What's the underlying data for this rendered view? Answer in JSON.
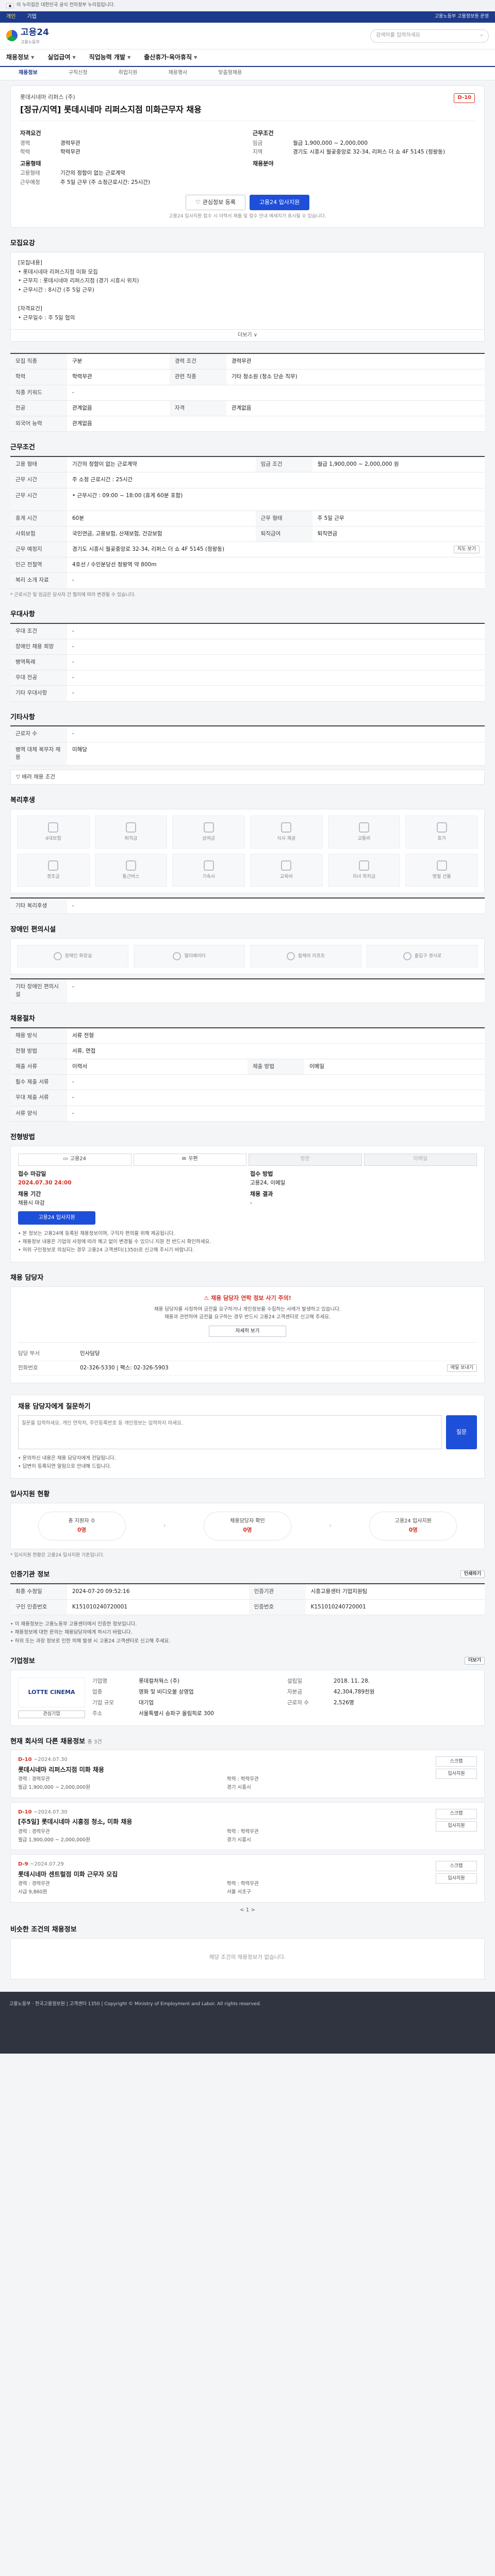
{
  "gov_bar": {
    "text": "이 누리집은 대한민국 공식 전자정부 누리집입니다."
  },
  "util_bar": {
    "items": [
      "개인",
      "기업"
    ],
    "active": "개인",
    "right": "고용노동부 고용정보원 운영"
  },
  "logo": {
    "name": "고용24",
    "sub": "고용노동부"
  },
  "search": {
    "placeholder": "검색어를 입력하세요"
  },
  "main_nav": [
    "채용정보",
    "실업급여",
    "직업능력 개발",
    "출산휴가·육아휴직"
  ],
  "sub_nav": [
    "채용정보",
    "구직신청",
    "취업지원",
    "채용행사",
    "맞춤형채용"
  ],
  "job": {
    "company": "롯데시네마 리퍼스 (주)",
    "title": "[정규/지역] 롯데시네마 리퍼스지점 미화근무자 채용",
    "dday": "D-10",
    "left_block_title": "자격요건",
    "left_kv": [
      [
        "경력",
        "경력무관"
      ],
      [
        "학력",
        "학력무관"
      ]
    ],
    "right_block_title": "근무조건",
    "right_kv": [
      [
        "임금",
        "월급 1,900,000 ~ 2,000,000"
      ],
      [
        "지역",
        "경기도 시흥시 월곶중앙로 32-34, 리퍼스 더 쇼 4F 5145 (정왕동)"
      ]
    ],
    "left_block2_title": "고용형태",
    "left_kv2": [
      [
        "고용형태",
        "기간의 정함이 없는 근로계약"
      ],
      [
        "근무예정",
        "주 5일 근무 (주 소정근로시간: 25시간)"
      ]
    ],
    "right_block2_title": "채용분야",
    "buttons": {
      "save": "관심정보 등록",
      "apply": "고용24 입사지원"
    },
    "note": "고용24 입사지원 접수 시 이력서 제출 및 접수 안내 메세지가 표시될 수 있습니다."
  },
  "recruit": {
    "title": "모집요강",
    "body": "[모집내용]\n• 롯데시네마 리퍼스지점 미화 모집\n• 근무지 : 롯데시네마 리퍼스지점 (경기 시흥시 위치)\n• 근무시간 : 8시간 (주 5일 근무)\n\n[자격요건]\n• 근무일수 : 주 5일 협의",
    "more": "더보기 ∨"
  },
  "qual_table": {
    "rows": [
      [
        "모집 직종",
        "구분",
        "경력 조건",
        "경력무관"
      ],
      [
        "학력",
        "학력무관",
        "관련 직종",
        "기타 청소원 (청소 단순 직무)"
      ],
      [
        "직종 키워드",
        "-",
        "",
        ""
      ],
      [
        "전공",
        "관계없음",
        "자격",
        "관계없음"
      ],
      [
        "외국어 능력",
        "관계없음",
        "",
        ""
      ]
    ]
  },
  "conditions": {
    "title": "근무조건",
    "rows": [
      [
        "고용 형태",
        "기간의 정함이 없는 근로계약",
        "임금 조건",
        "월급 1,900,000 ~ 2,000,000 원"
      ],
      [
        "근무 시간",
        "주 소정 근로시간 : 25시간",
        "",
        ""
      ],
      [
        "근무 시간",
        "• 근무시간 : 09:00 ~ 18:00 (휴게 60분 포함)",
        "",
        ""
      ],
      [
        "휴게 시간",
        "60분",
        "근무 형태",
        "주 5일 근무"
      ],
      [
        "사회보험",
        "국민연금, 고용보험, 산재보험, 건강보험",
        "퇴직급여",
        "퇴직연금"
      ],
      [
        "근무 예정지",
        "경기도 시흥시 월곶중앙로 32-34, 리퍼스 더 쇼 4F 5145 (정왕동)",
        "",
        ""
      ],
      [
        "인근 전철역",
        "4호선 / 수인분당선 정왕역 약 800m",
        "",
        ""
      ],
      [
        "복리 소개 자료",
        "-",
        "",
        ""
      ]
    ],
    "map_btn": "지도 보기",
    "note": "* 근로시간 및 임금은 당사자 간 협의에 따라 변경될 수 있습니다."
  },
  "prefer": {
    "title": "우대사항",
    "rows": [
      [
        "우대 조건",
        "-"
      ],
      [
        "장애인 채용 희망",
        "-"
      ],
      [
        "병역특례",
        "-"
      ],
      [
        "우대 전공",
        "-"
      ],
      [
        "기타 우대사항",
        "-"
      ]
    ]
  },
  "other_info": {
    "title": "기타사항",
    "rows": [
      [
        "근로자 수",
        "-"
      ],
      [
        "병역 대체 복무자 채용",
        "미해당"
      ]
    ],
    "dropdown": "배려 채용 조건"
  },
  "welfare": {
    "title": "복리후생",
    "icons": [
      "4대보험",
      "퇴직금",
      "상여금",
      "식사 제공",
      "교통비",
      "휴가",
      "경조금",
      "통근버스",
      "기숙사",
      "교육비",
      "자녀 학자금",
      "명절 선물"
    ],
    "etc_label": "기타 복리후생",
    "etc_value": "-"
  },
  "disability": {
    "title": "장애인 편의시설",
    "icons": [
      "장애인 화장실",
      "엘리베이터",
      "휠체어 리프트",
      "출입구 경사로"
    ],
    "etc_label": "기타 장애인 편의시설",
    "etc_value": "-"
  },
  "selection": {
    "title": "채용절차",
    "rows": [
      [
        "채용 방식",
        "서류 전형",
        "",
        ""
      ],
      [
        "전형 방법",
        "서류, 면접",
        "",
        ""
      ],
      [
        "제출 서류",
        "이력서",
        "제출 방법",
        "이메일"
      ],
      [
        "필수 제출 서류",
        "-",
        "",
        ""
      ],
      [
        "우대 제출 서류",
        "-",
        "",
        ""
      ],
      [
        "서류 양식",
        "-",
        "",
        ""
      ]
    ]
  },
  "apply": {
    "title": "전형방법",
    "tabs": [
      "고용24",
      "우편",
      "방문",
      "이메일"
    ],
    "deadline_label": "접수 마감일",
    "deadline": "2024.07.30 24:00",
    "method_label": "접수 방법",
    "method": "고용24, 이메일",
    "period_label": "채용 기간",
    "period_value": "채용시 마감",
    "result_label": "채용 결과",
    "result_value": "-",
    "apply_btn": "고용24 입사지원",
    "bullets": [
      "• 본 정보는 고용24에 등록된 채용정보이며, 구직자 편의를 위해 제공됩니다.",
      "• 채용정보 내용은 기업의 사정에 따라 예고 없이 변경될 수 있으니 지원 전 반드시 확인하세요.",
      "• 허위 구인정보로 의심되는 경우 고용24 고객센터(1350)로 신고해 주시기 바랍니다."
    ]
  },
  "contact": {
    "title": "채용 담당자",
    "warn": "채용 담당자 연락 정보 사기 주의!",
    "warn_sub": "채용 담당자를 사칭하여 금전을 요구하거나 개인정보를 수집하는 사례가 발생하고 있습니다.\n채용과 관련하여 금전을 요구하는 경우 반드시 고용24 고객센터로 신고해 주세요.",
    "warn_btn": "자세히 보기",
    "rows": [
      [
        "담당 부서",
        "인사담당"
      ],
      [
        "전화번호",
        "02-326-5330  |  팩스: 02-326-5903"
      ]
    ],
    "email_btn": "메일 보내기"
  },
  "inquiry": {
    "title": "채용 담당자에게 질문하기",
    "placeholder": "질문을 입력하세요. 개인 연락처, 주민등록번호 등 개인정보는 입력하지 마세요.",
    "submit": "질문",
    "notes": [
      "• 문의하신 내용은 채용 담당자에게 전달됩니다.",
      "• 답변이 등록되면 알림으로 안내해 드립니다."
    ]
  },
  "status": {
    "title": "입사지원 현황",
    "steps": [
      [
        "총 지원자 수",
        "0명"
      ],
      [
        "채용담당자 확인",
        "0명"
      ],
      [
        "고용24 입사지원",
        "0명"
      ]
    ],
    "note": "* 입사지원 현황은 고용24 입사지원 기준입니다."
  },
  "reg_info": {
    "title": "인증기관 정보",
    "rows": [
      [
        "최종 수정일",
        "2024-07-20 09:52:16",
        "인증기관",
        "시흥고용센터 기업지원팀"
      ],
      [
        "구인 인증번호",
        "K151010240720001",
        "인증번호",
        "K151010240720001"
      ]
    ],
    "btn": "인쇄하기",
    "bullets": [
      "• 이 채용정보는 고용노동부 고용센터에서 인증한 정보입니다.",
      "• 채용정보에 대한 문의는 채용담당자에게 하시기 바랍니다.",
      "• 허위 또는 과장 정보로 인한 피해 발생 시 고용24 고객센터로 신고해 주세요."
    ]
  },
  "company": {
    "title": "기업정보",
    "more": "더보기",
    "logo_text": "LOTTE CINEMA",
    "follow_btn": "관심기업",
    "rows": [
      [
        "기업명",
        "롯데컬처웍스 (주)",
        "설립일",
        "2018. 11. 28."
      ],
      [
        "업종",
        "영화 및 비디오물 상영업",
        "자본금",
        "42,304,789천원"
      ],
      [
        "기업 규모",
        "대기업",
        "근로자 수",
        "2,526명"
      ],
      [
        "주소",
        "서울특별시 송파구 올림픽로 300",
        "",
        ""
      ]
    ]
  },
  "other_jobs": {
    "title": "현재 회사의 다른 채용정보",
    "count_label": "총 3건",
    "items": [
      {
        "dday": "D-10",
        "title": "롯데시네마 리퍼스지점 미화 채용",
        "meta": [
          "경력 : 경력무관",
          "학력 : 학력무관",
          "월급 1,900,000 ~ 2,000,000원",
          "경기 시흥시"
        ],
        "date": "~2024.07.30"
      },
      {
        "dday": "D-10",
        "title": "[주5일] 롯데시네마 시흥점 청소, 미화 채용",
        "meta": [
          "경력 : 경력무관",
          "학력 : 학력무관",
          "월급 1,900,000 ~ 2,000,000원",
          "경기 시흥시"
        ],
        "date": "~2024.07.30"
      },
      {
        "dday": "D-9",
        "title": "롯데시네마 센트럴점 미화 근무자 모집",
        "meta": [
          "경력 : 경력무관",
          "학력 : 학력무관",
          "시급 9,860원",
          "서울 서초구"
        ],
        "date": "~2024.07.29"
      }
    ],
    "actions": [
      "스크랩",
      "입사지원"
    ],
    "pager": "< 1 >"
  },
  "similar": {
    "title": "비슷한 조건의 채용정보",
    "empty": "해당 조건의 채용정보가 없습니다."
  },
  "footer": {
    "text": "고용노동부 · 한국고용정보원  |  고객센터 1350  |  Copyright © Ministry of Employment and Labor. All rights reserved."
  }
}
